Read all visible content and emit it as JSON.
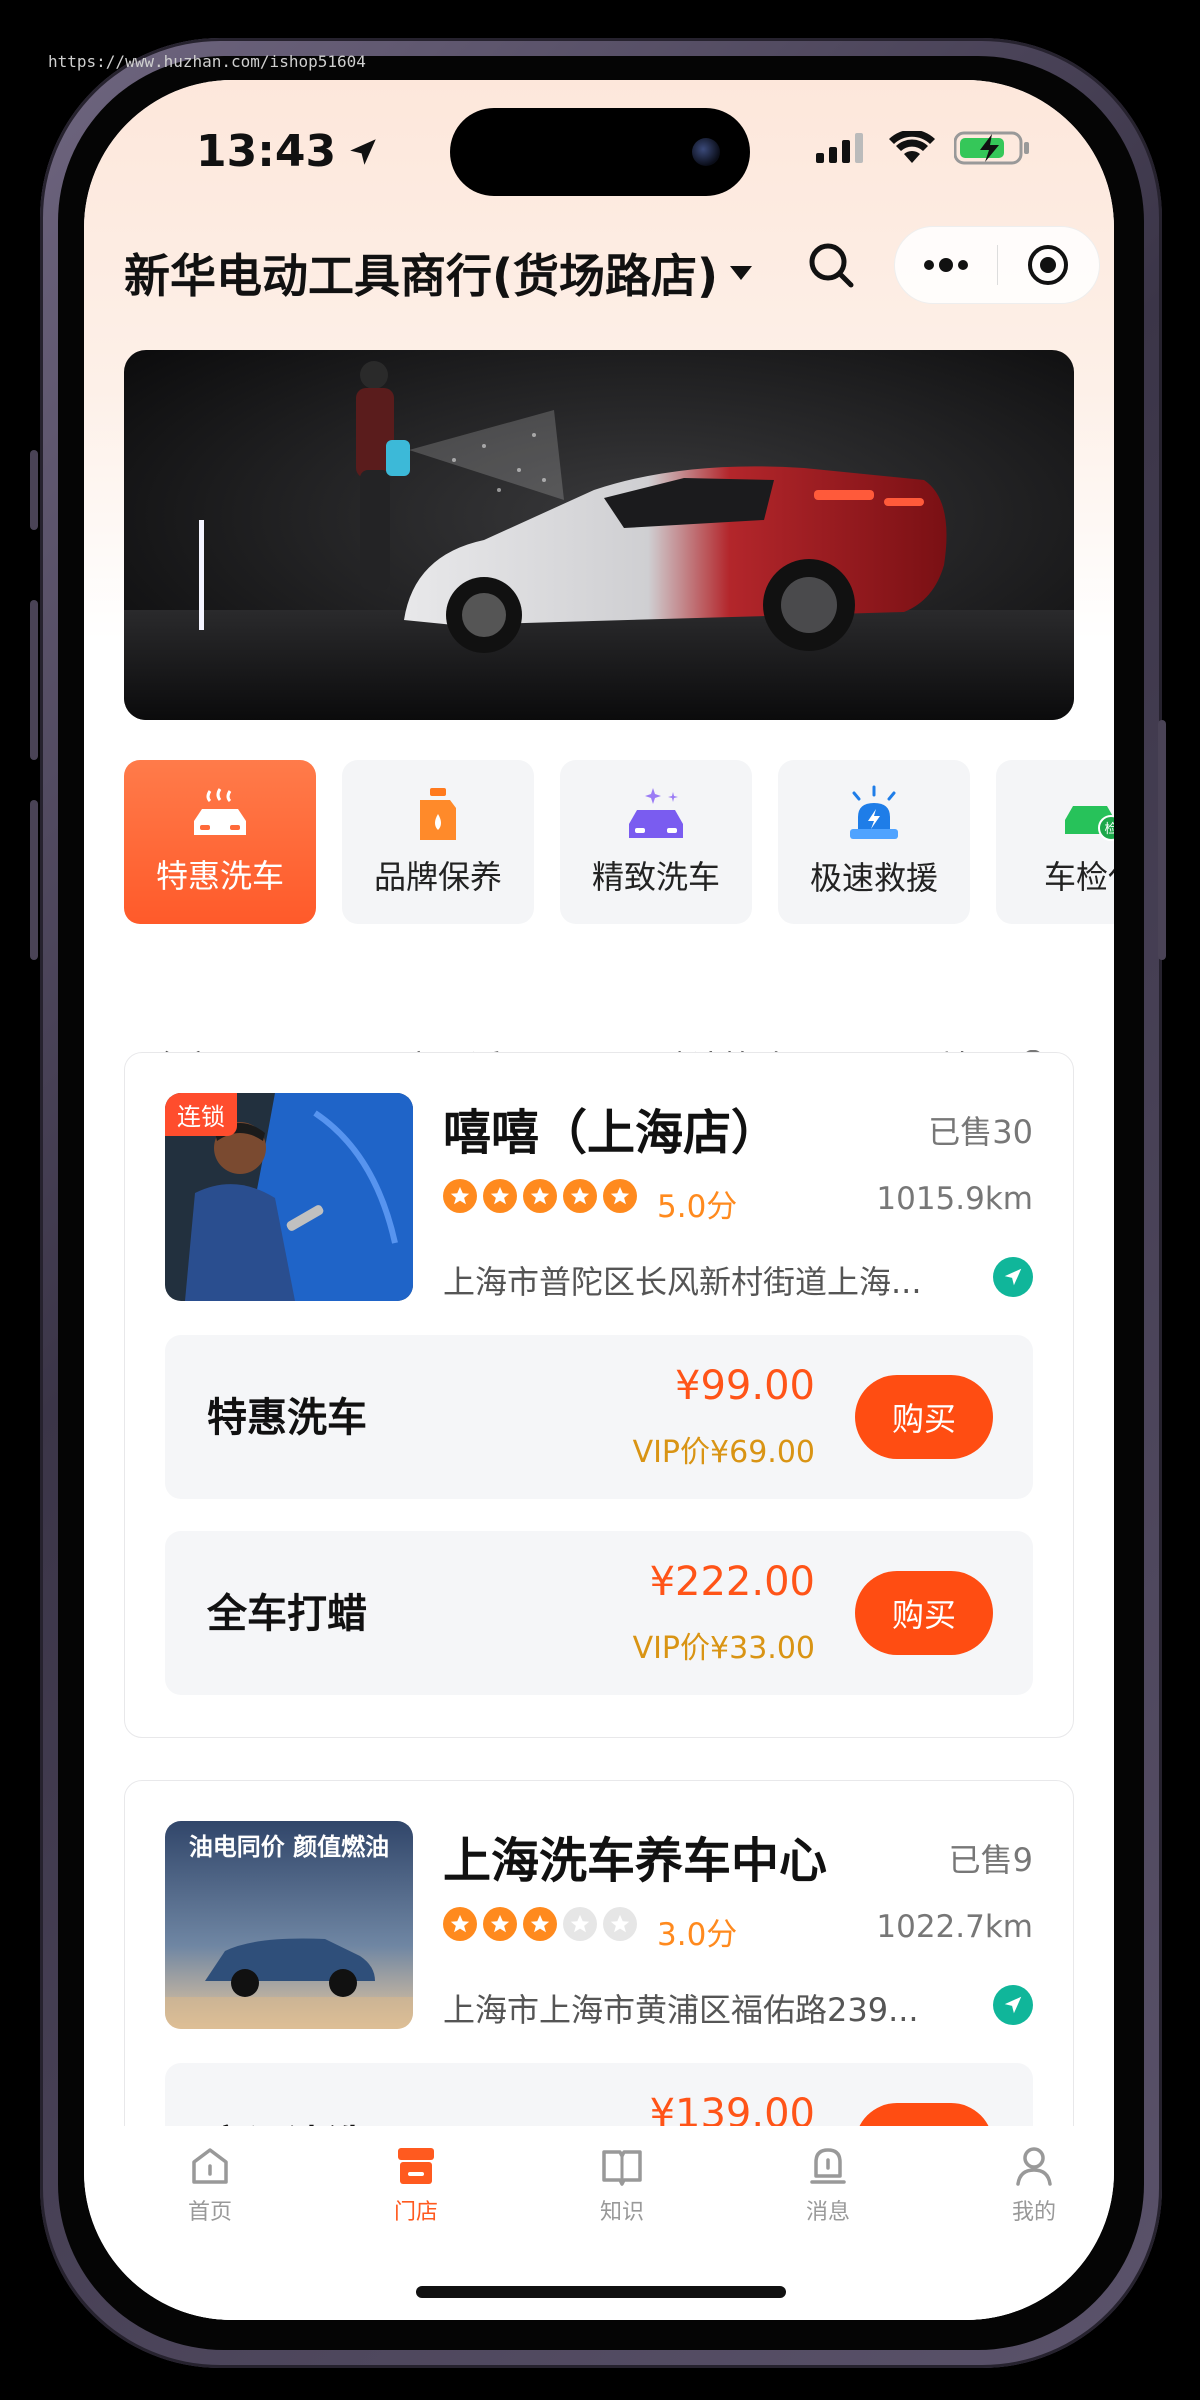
{
  "watermark": "https://www.huzhan.com/ishop51604",
  "status": {
    "time": "13:43"
  },
  "header": {
    "store_title": "新华电动工具商行(货场路店)"
  },
  "categories": [
    {
      "label": "特惠洗车",
      "icon": "car-wash-icon",
      "active": true
    },
    {
      "label": "品牌保养",
      "icon": "oil-can-icon"
    },
    {
      "label": "精致洗车",
      "icon": "sparkle-car-icon"
    },
    {
      "label": "极速救援",
      "icon": "rescue-siren-icon"
    },
    {
      "label": "车检代",
      "icon": "inspection-car-icon"
    }
  ],
  "filters": [
    {
      "label": "全市"
    },
    {
      "label": "距离最近"
    },
    {
      "label": "默认筛选"
    },
    {
      "label": "地图"
    }
  ],
  "stores": [
    {
      "tag": "连锁",
      "name": "嘻嘻（上海店）",
      "sold": "已售30",
      "rating_stars": 5,
      "score": "5.0分",
      "distance": "1015.9km",
      "address": "上海市普陀区长风新村街道上海...",
      "services": [
        {
          "name": "特惠洗车",
          "price": "¥99.00",
          "vip": "VIP价¥69.00",
          "button": "购买"
        },
        {
          "name": "全车打蜡",
          "price": "¥222.00",
          "vip": "VIP价¥33.00",
          "button": "购买"
        }
      ]
    },
    {
      "name": "上海洗车养车中心",
      "sold": "已售9",
      "rating_stars": 3,
      "score": "3.0分",
      "distance": "1022.7km",
      "address": "上海市上海市黄浦区福佑路239...",
      "thumb_text": "油电同价 颜值燃油",
      "services": [
        {
          "name": "空调清洗",
          "price": "¥139.00",
          "button": "购买"
        }
      ]
    }
  ],
  "tabbar": [
    {
      "label": "首页",
      "icon": "home-icon"
    },
    {
      "label": "门店",
      "icon": "store-icon",
      "active": true
    },
    {
      "label": "知识",
      "icon": "book-icon"
    },
    {
      "label": "消息",
      "icon": "bell-icon"
    },
    {
      "label": "我的",
      "icon": "user-icon"
    }
  ],
  "colors": {
    "accent": "#ff4d12",
    "star": "#ff8a1e",
    "vip": "#d99414",
    "nav": "#10b69a"
  }
}
